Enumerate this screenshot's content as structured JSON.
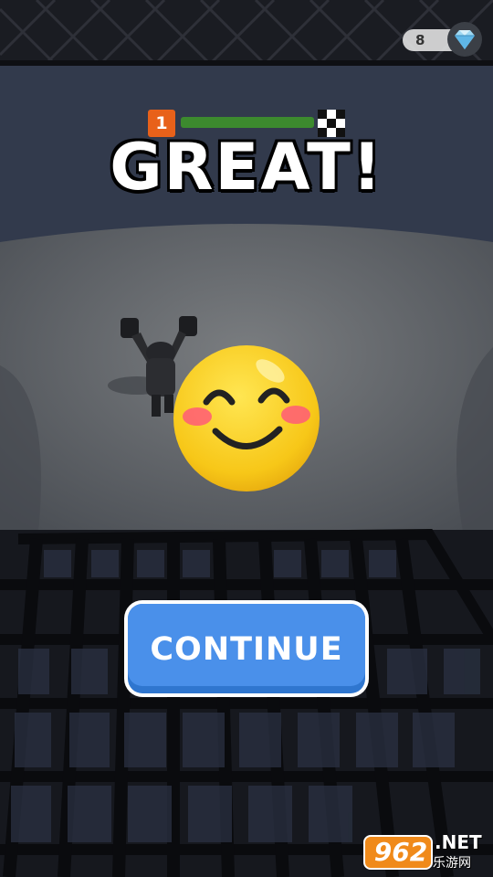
{
  "hud": {
    "gems": {
      "count": "8",
      "icon": "diamond-icon"
    },
    "level": {
      "number": "1",
      "progress": 1.0,
      "finish_icon": "checkered-flag-icon"
    }
  },
  "result": {
    "headline": "GREAT!",
    "emoji": "smiling-face-with-blush-icon"
  },
  "actions": {
    "continue_label": "CONTINUE"
  },
  "watermark": {
    "number": "962",
    "domain": ".NET",
    "site": "乐游网"
  },
  "colors": {
    "button": "#4a90ea",
    "button_shadow": "#2f76cf",
    "level_badge": "#e8611a",
    "progress_fill": "#3c8a2e",
    "emoji_yellow": "#fcd21c",
    "watermark_orange": "#f08a1a"
  }
}
